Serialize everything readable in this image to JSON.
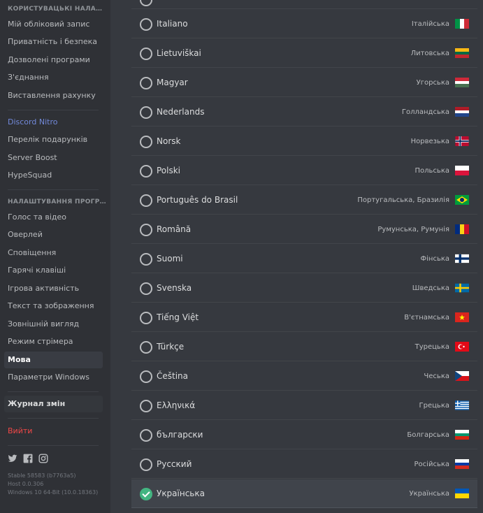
{
  "sidebar": {
    "user_settings_header": "КОРИСТУВАЦЬКІ НАЛАШТУВАННЯ",
    "user_items": [
      "Мій обліковий запис",
      "Приватність і безпека",
      "Дозволені програми",
      "З'єднання",
      "Виставлення рахунку"
    ],
    "nitro_items": [
      "Discord Nitro",
      "Перелік подарунків",
      "Server Boost",
      "HypeSquad"
    ],
    "app_settings_header": "НАЛАШТУВАННЯ ПРОГРАМИ",
    "app_items": [
      "Голос та відео",
      "Оверлей",
      "Сповіщення",
      "Гарячі клавіші",
      "Ігрова активність",
      "Текст та зображення",
      "Зовнішній вигляд",
      "Режим стрімера",
      "Мова",
      "Параметри Windows"
    ],
    "selected_item": "Мова",
    "changelog": "Журнал змін",
    "logout": "Вийти",
    "social_icons": [
      "twitter-icon",
      "facebook-icon",
      "instagram-icon"
    ],
    "build_info": [
      "Stable 58583 (b7763a5)",
      "Host 0.0.306",
      "Windows 10 64-Bit (10.0.18363)"
    ]
  },
  "languages": [
    {
      "name": "Italiano",
      "native": "Італійська",
      "flag": "it"
    },
    {
      "name": "Lietuviškai",
      "native": "Литовська",
      "flag": "lt"
    },
    {
      "name": "Magyar",
      "native": "Угорська",
      "flag": "hu"
    },
    {
      "name": "Nederlands",
      "native": "Голландська",
      "flag": "nl"
    },
    {
      "name": "Norsk",
      "native": "Норвезька",
      "flag": "no"
    },
    {
      "name": "Polski",
      "native": "Польська",
      "flag": "pl"
    },
    {
      "name": "Português do Brasil",
      "native": "Португальська, Бразилія",
      "flag": "br"
    },
    {
      "name": "Română",
      "native": "Румунська, Румунія",
      "flag": "ro"
    },
    {
      "name": "Suomi",
      "native": "Фінська",
      "flag": "fi"
    },
    {
      "name": "Svenska",
      "native": "Шведська",
      "flag": "se"
    },
    {
      "name": "Tiếng Việt",
      "native": "В'єтнамська",
      "flag": "vn"
    },
    {
      "name": "Türkçe",
      "native": "Турецька",
      "flag": "tr"
    },
    {
      "name": "Čeština",
      "native": "Чеська",
      "flag": "cz"
    },
    {
      "name": "Ελληνικά",
      "native": "Грецька",
      "flag": "gr"
    },
    {
      "name": "български",
      "native": "Болгарська",
      "flag": "bg"
    },
    {
      "name": "Русский",
      "native": "Російська",
      "flag": "ru"
    },
    {
      "name": "Українська",
      "native": "Українська",
      "flag": "ua",
      "selected": true
    }
  ],
  "colors": {
    "accent": "#7289da",
    "selected_check": "#43b581",
    "logout": "#f04747"
  }
}
